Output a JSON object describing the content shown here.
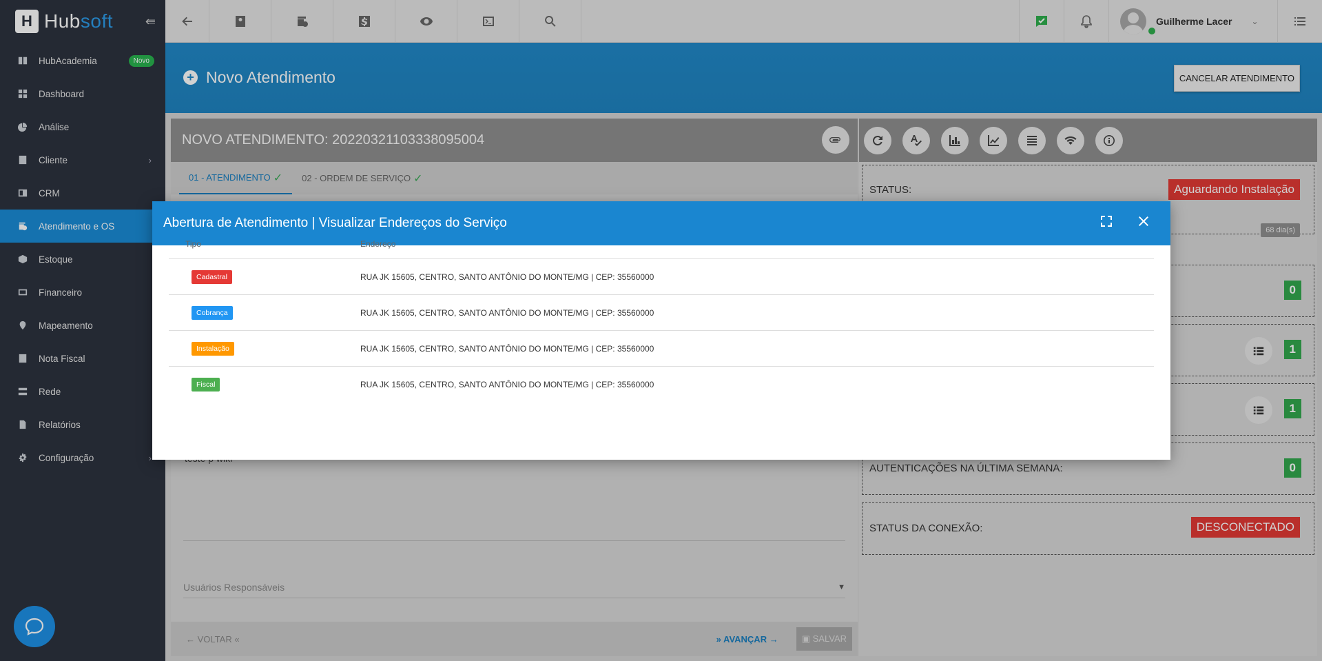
{
  "brand": {
    "name_part1": "Hub",
    "name_part2": "soft"
  },
  "sidebar": {
    "items": [
      {
        "label": "HubAcademia",
        "badge": "Novo",
        "icon": "book-icon"
      },
      {
        "label": "Dashboard",
        "icon": "dashboard-icon"
      },
      {
        "label": "Análise",
        "icon": "pie-chart-icon"
      },
      {
        "label": "Cliente",
        "icon": "contact-card-icon",
        "has_submenu": true
      },
      {
        "label": "CRM",
        "icon": "crm-icon"
      },
      {
        "label": "Atendimento e OS",
        "icon": "calendar-clock-icon",
        "active": true
      },
      {
        "label": "Estoque",
        "icon": "box-icon"
      },
      {
        "label": "Financeiro",
        "icon": "money-icon"
      },
      {
        "label": "Mapeamento",
        "icon": "map-pin-icon"
      },
      {
        "label": "Nota Fiscal",
        "icon": "receipt-icon"
      },
      {
        "label": "Rede",
        "icon": "network-icon"
      },
      {
        "label": "Relatórios",
        "icon": "report-icon"
      },
      {
        "label": "Configuração",
        "icon": "gear-icon",
        "has_submenu": true
      }
    ]
  },
  "topbar": {
    "user_name": "Guilherme Lacer",
    "icons": [
      "back-arrow-icon",
      "contact-icon",
      "calendar-clock-icon",
      "dollar-icon",
      "eye-icon",
      "terminal-icon",
      "search-icon"
    ],
    "right_icons": [
      "chat-check-icon",
      "bell-icon",
      "menu-list-icon"
    ]
  },
  "header": {
    "title": "Novo Atendimento",
    "cancel_label": "CANCELAR ATENDIMENTO"
  },
  "left_panel": {
    "title": "NOVO ATENDIMENTO: 20220321103338095004",
    "tabs": [
      {
        "label": "01 - ATENDIMENTO",
        "active": true
      },
      {
        "label": "02 - ORDEM DE SERVIÇO",
        "active": false
      }
    ],
    "description_text": "teste p wiki",
    "users_placeholder": "Usuários Responsáveis",
    "back_label": "VOLTAR",
    "next_label": "AVANÇAR",
    "save_label": "SALVAR"
  },
  "right_panel": {
    "status_label": "STATUS:",
    "status_value": "Aguardando Instalação",
    "days_badge": "68 dia(s)",
    "count_a": "0",
    "count_b": "1",
    "count_c": "1",
    "auth_label": "AUTENTICAÇÕES NA ÚLTIMA SEMANA:",
    "auth_value": "0",
    "connection_label": "STATUS DA CONEXÃO:",
    "connection_value": "DESCONECTADO"
  },
  "modal": {
    "title": "Abertura de Atendimento | Visualizar Endereços do Serviço",
    "columns": {
      "tipo": "Tipo",
      "endereco": "Endereço"
    },
    "rows": [
      {
        "tipo": "Cadastral",
        "color": "#e53935",
        "endereco": "RUA JK 15605, CENTRO, SANTO ANTÔNIO DO MONTE/MG | CEP: 35560000"
      },
      {
        "tipo": "Cobrança",
        "color": "#2196f3",
        "endereco": "RUA JK 15605, CENTRO, SANTO ANTÔNIO DO MONTE/MG | CEP: 35560000"
      },
      {
        "tipo": "Instalação",
        "color": "#ff9800",
        "endereco": "RUA JK 15605, CENTRO, SANTO ANTÔNIO DO MONTE/MG | CEP: 35560000"
      },
      {
        "tipo": "Fiscal",
        "color": "#4caf50",
        "endereco": "RUA JK 15605, CENTRO, SANTO ANTÔNIO DO MONTE/MG | CEP: 35560000"
      }
    ]
  },
  "colors": {
    "primary": "#1a86d0",
    "sidebar_bg": "#2c323f",
    "danger": "#e23a35",
    "success": "#33a84d"
  }
}
